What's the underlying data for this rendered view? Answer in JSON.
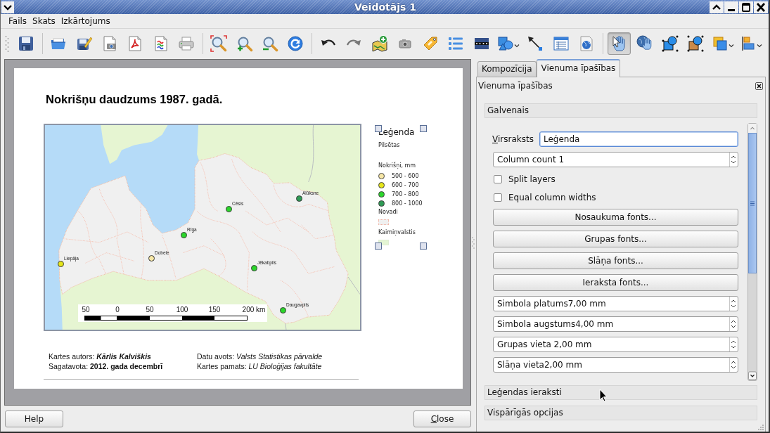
{
  "window": {
    "title": "Veidotājs 1"
  },
  "menu": [
    "Fails",
    "Skats",
    "Izkārtojums"
  ],
  "toolbar": {
    "tools": [
      {
        "selected": true
      },
      {
        "selected": false
      }
    ]
  },
  "page": {
    "title": "Nokrišņu daudzums 1987. gadā.",
    "map": {
      "cities": [
        {
          "name": "Alūksne",
          "color": "#2e9b55"
        },
        {
          "name": "Cēsis",
          "color": "#2bd62b"
        },
        {
          "name": "Rīga",
          "color": "#2bd62b"
        },
        {
          "name": "Dobele",
          "color": "#f7e7a6"
        },
        {
          "name": "Liepāja",
          "color": "#e6e619"
        },
        {
          "name": "Jēkabpils",
          "color": "#2bd62b"
        },
        {
          "name": "Daugavpils",
          "color": "#2bd62b"
        }
      ],
      "scale_labels": [
        "50",
        "0",
        "50",
        "100",
        "150",
        "200 km"
      ]
    },
    "legend": {
      "selected": true,
      "title": "Leģenda",
      "entries": [
        {
          "kind": "group",
          "label": "Pilsētas"
        },
        {
          "kind": "group",
          "label": "Nokrišņi, mm"
        },
        {
          "kind": "point",
          "label": "500 - 600",
          "color": "#f7e7a6"
        },
        {
          "kind": "point",
          "label": "600 - 700",
          "color": "#e6e619"
        },
        {
          "kind": "point",
          "label": "700 - 800",
          "color": "#2bd62b"
        },
        {
          "kind": "point",
          "label": "800 - 1000",
          "color": "#2e9b55"
        },
        {
          "kind": "group",
          "label": "Novadi"
        },
        {
          "kind": "fill",
          "color": "#f0f0f0"
        },
        {
          "kind": "group",
          "label": "Kaimiņvalstis"
        },
        {
          "kind": "fill",
          "color": "#e4f5d4"
        }
      ]
    },
    "credit_columns": [
      [
        {
          "label": "Kartes autors:",
          "value": "Kārlis Kalviškis",
          "bold": true,
          "italic": true
        },
        {
          "label": "Sagatavota:",
          "value": "2012. gada decembrī",
          "bold": true,
          "italic": false
        }
      ],
      [
        {
          "label": "Datu avots:",
          "value": "Valsts Statistikas pārvalde",
          "bold": false,
          "italic": true
        },
        {
          "label": "Kartes pamats:",
          "value": "LU Bioloģijas fakultāte",
          "bold": false,
          "italic": true
        }
      ]
    ]
  },
  "dock": {
    "tabs": [
      {
        "label": "Kompozīcija",
        "selected": false
      },
      {
        "label": "Vienuma īpašības",
        "selected": true
      }
    ],
    "title": "Vienuma īpašības",
    "main_section": {
      "label": "Galvenais",
      "title_field": {
        "label": "Virsraksts",
        "value": "Leģenda",
        "focused": true,
        "mnemonic": true
      },
      "controls": [
        {
          "kind": "spin",
          "value": "Column count 1"
        },
        {
          "kind": "checkbox",
          "label": "Split layers",
          "checked": false
        },
        {
          "kind": "checkbox",
          "label": "Equal column widths",
          "checked": false
        },
        {
          "kind": "button",
          "label": "Nosaukuma fonts..."
        },
        {
          "kind": "button",
          "label": "Grupas fonts..."
        },
        {
          "kind": "button",
          "label": "Slāņa fonts..."
        },
        {
          "kind": "button",
          "label": "Ieraksta fonts..."
        },
        {
          "kind": "spin",
          "value": "Simbola platums7,00 mm"
        },
        {
          "kind": "spin",
          "value": "Simbola augstums4,00 mm"
        },
        {
          "kind": "spin",
          "value": "Grupas vieta 2,00 mm"
        },
        {
          "kind": "spin",
          "value": "Slāņa vieta2,00 mm"
        }
      ]
    },
    "sections": [
      {
        "label": "Leģendas ieraksti"
      },
      {
        "label": "Vispārīgās opcijas"
      }
    ]
  },
  "buttons": [
    {
      "label": "Help",
      "mnemonic": false
    },
    {
      "label": "Close",
      "mnemonic": true
    }
  ]
}
